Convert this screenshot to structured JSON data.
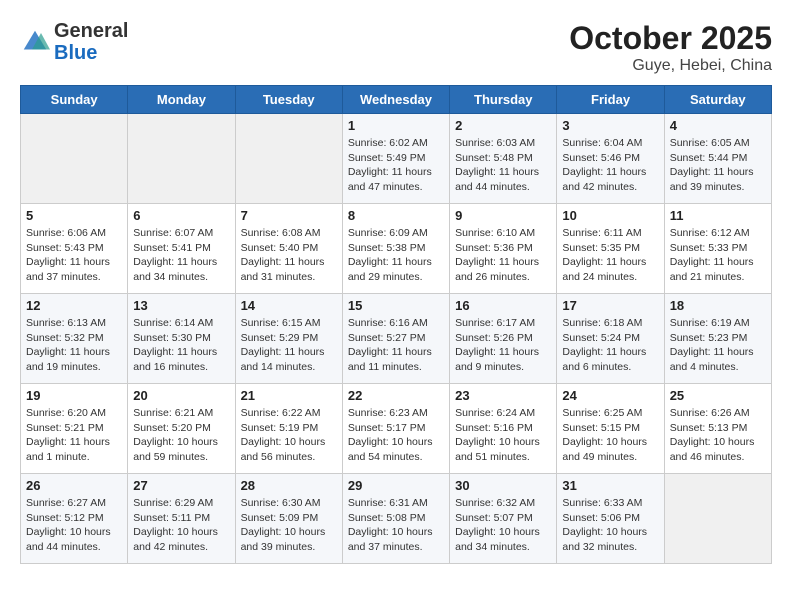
{
  "logo": {
    "general": "General",
    "blue": "Blue"
  },
  "title": "October 2025",
  "subtitle": "Guye, Hebei, China",
  "weekdays": [
    "Sunday",
    "Monday",
    "Tuesday",
    "Wednesday",
    "Thursday",
    "Friday",
    "Saturday"
  ],
  "weeks": [
    [
      {
        "day": "",
        "info": ""
      },
      {
        "day": "",
        "info": ""
      },
      {
        "day": "",
        "info": ""
      },
      {
        "day": "1",
        "sunrise": "Sunrise: 6:02 AM",
        "sunset": "Sunset: 5:49 PM",
        "daylight": "Daylight: 11 hours and 47 minutes."
      },
      {
        "day": "2",
        "sunrise": "Sunrise: 6:03 AM",
        "sunset": "Sunset: 5:48 PM",
        "daylight": "Daylight: 11 hours and 44 minutes."
      },
      {
        "day": "3",
        "sunrise": "Sunrise: 6:04 AM",
        "sunset": "Sunset: 5:46 PM",
        "daylight": "Daylight: 11 hours and 42 minutes."
      },
      {
        "day": "4",
        "sunrise": "Sunrise: 6:05 AM",
        "sunset": "Sunset: 5:44 PM",
        "daylight": "Daylight: 11 hours and 39 minutes."
      }
    ],
    [
      {
        "day": "5",
        "sunrise": "Sunrise: 6:06 AM",
        "sunset": "Sunset: 5:43 PM",
        "daylight": "Daylight: 11 hours and 37 minutes."
      },
      {
        "day": "6",
        "sunrise": "Sunrise: 6:07 AM",
        "sunset": "Sunset: 5:41 PM",
        "daylight": "Daylight: 11 hours and 34 minutes."
      },
      {
        "day": "7",
        "sunrise": "Sunrise: 6:08 AM",
        "sunset": "Sunset: 5:40 PM",
        "daylight": "Daylight: 11 hours and 31 minutes."
      },
      {
        "day": "8",
        "sunrise": "Sunrise: 6:09 AM",
        "sunset": "Sunset: 5:38 PM",
        "daylight": "Daylight: 11 hours and 29 minutes."
      },
      {
        "day": "9",
        "sunrise": "Sunrise: 6:10 AM",
        "sunset": "Sunset: 5:36 PM",
        "daylight": "Daylight: 11 hours and 26 minutes."
      },
      {
        "day": "10",
        "sunrise": "Sunrise: 6:11 AM",
        "sunset": "Sunset: 5:35 PM",
        "daylight": "Daylight: 11 hours and 24 minutes."
      },
      {
        "day": "11",
        "sunrise": "Sunrise: 6:12 AM",
        "sunset": "Sunset: 5:33 PM",
        "daylight": "Daylight: 11 hours and 21 minutes."
      }
    ],
    [
      {
        "day": "12",
        "sunrise": "Sunrise: 6:13 AM",
        "sunset": "Sunset: 5:32 PM",
        "daylight": "Daylight: 11 hours and 19 minutes."
      },
      {
        "day": "13",
        "sunrise": "Sunrise: 6:14 AM",
        "sunset": "Sunset: 5:30 PM",
        "daylight": "Daylight: 11 hours and 16 minutes."
      },
      {
        "day": "14",
        "sunrise": "Sunrise: 6:15 AM",
        "sunset": "Sunset: 5:29 PM",
        "daylight": "Daylight: 11 hours and 14 minutes."
      },
      {
        "day": "15",
        "sunrise": "Sunrise: 6:16 AM",
        "sunset": "Sunset: 5:27 PM",
        "daylight": "Daylight: 11 hours and 11 minutes."
      },
      {
        "day": "16",
        "sunrise": "Sunrise: 6:17 AM",
        "sunset": "Sunset: 5:26 PM",
        "daylight": "Daylight: 11 hours and 9 minutes."
      },
      {
        "day": "17",
        "sunrise": "Sunrise: 6:18 AM",
        "sunset": "Sunset: 5:24 PM",
        "daylight": "Daylight: 11 hours and 6 minutes."
      },
      {
        "day": "18",
        "sunrise": "Sunrise: 6:19 AM",
        "sunset": "Sunset: 5:23 PM",
        "daylight": "Daylight: 11 hours and 4 minutes."
      }
    ],
    [
      {
        "day": "19",
        "sunrise": "Sunrise: 6:20 AM",
        "sunset": "Sunset: 5:21 PM",
        "daylight": "Daylight: 11 hours and 1 minute."
      },
      {
        "day": "20",
        "sunrise": "Sunrise: 6:21 AM",
        "sunset": "Sunset: 5:20 PM",
        "daylight": "Daylight: 10 hours and 59 minutes."
      },
      {
        "day": "21",
        "sunrise": "Sunrise: 6:22 AM",
        "sunset": "Sunset: 5:19 PM",
        "daylight": "Daylight: 10 hours and 56 minutes."
      },
      {
        "day": "22",
        "sunrise": "Sunrise: 6:23 AM",
        "sunset": "Sunset: 5:17 PM",
        "daylight": "Daylight: 10 hours and 54 minutes."
      },
      {
        "day": "23",
        "sunrise": "Sunrise: 6:24 AM",
        "sunset": "Sunset: 5:16 PM",
        "daylight": "Daylight: 10 hours and 51 minutes."
      },
      {
        "day": "24",
        "sunrise": "Sunrise: 6:25 AM",
        "sunset": "Sunset: 5:15 PM",
        "daylight": "Daylight: 10 hours and 49 minutes."
      },
      {
        "day": "25",
        "sunrise": "Sunrise: 6:26 AM",
        "sunset": "Sunset: 5:13 PM",
        "daylight": "Daylight: 10 hours and 46 minutes."
      }
    ],
    [
      {
        "day": "26",
        "sunrise": "Sunrise: 6:27 AM",
        "sunset": "Sunset: 5:12 PM",
        "daylight": "Daylight: 10 hours and 44 minutes."
      },
      {
        "day": "27",
        "sunrise": "Sunrise: 6:29 AM",
        "sunset": "Sunset: 5:11 PM",
        "daylight": "Daylight: 10 hours and 42 minutes."
      },
      {
        "day": "28",
        "sunrise": "Sunrise: 6:30 AM",
        "sunset": "Sunset: 5:09 PM",
        "daylight": "Daylight: 10 hours and 39 minutes."
      },
      {
        "day": "29",
        "sunrise": "Sunrise: 6:31 AM",
        "sunset": "Sunset: 5:08 PM",
        "daylight": "Daylight: 10 hours and 37 minutes."
      },
      {
        "day": "30",
        "sunrise": "Sunrise: 6:32 AM",
        "sunset": "Sunset: 5:07 PM",
        "daylight": "Daylight: 10 hours and 34 minutes."
      },
      {
        "day": "31",
        "sunrise": "Sunrise: 6:33 AM",
        "sunset": "Sunset: 5:06 PM",
        "daylight": "Daylight: 10 hours and 32 minutes."
      },
      {
        "day": "",
        "info": ""
      }
    ]
  ]
}
